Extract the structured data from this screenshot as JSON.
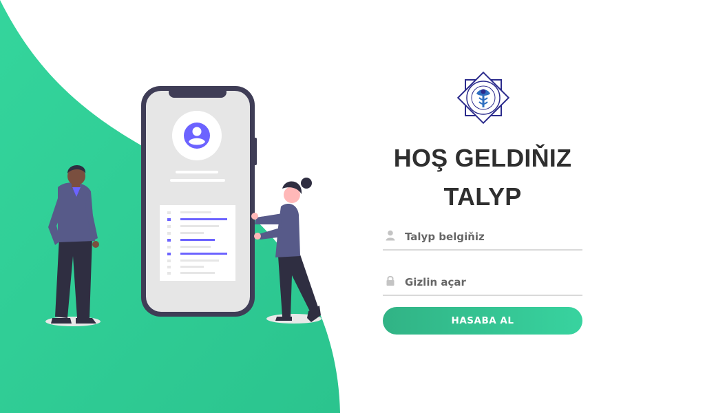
{
  "colors": {
    "accent": "#38d39f",
    "accent_dark": "#31b385",
    "illustration_purple": "#6c63ff",
    "figure_navy": "#3f3d56"
  },
  "logo": {
    "icon": "university-emblem-icon"
  },
  "welcome": {
    "line1": "HOŞ GELDIŇIZ",
    "line2": "TALYP"
  },
  "form": {
    "username": {
      "placeholder": "Talyp belgiňiz",
      "value": "",
      "icon": "user-icon"
    },
    "password": {
      "placeholder": "Gizlin açar",
      "value": "",
      "icon": "lock-icon"
    },
    "submit_label": "HASABA AL"
  }
}
